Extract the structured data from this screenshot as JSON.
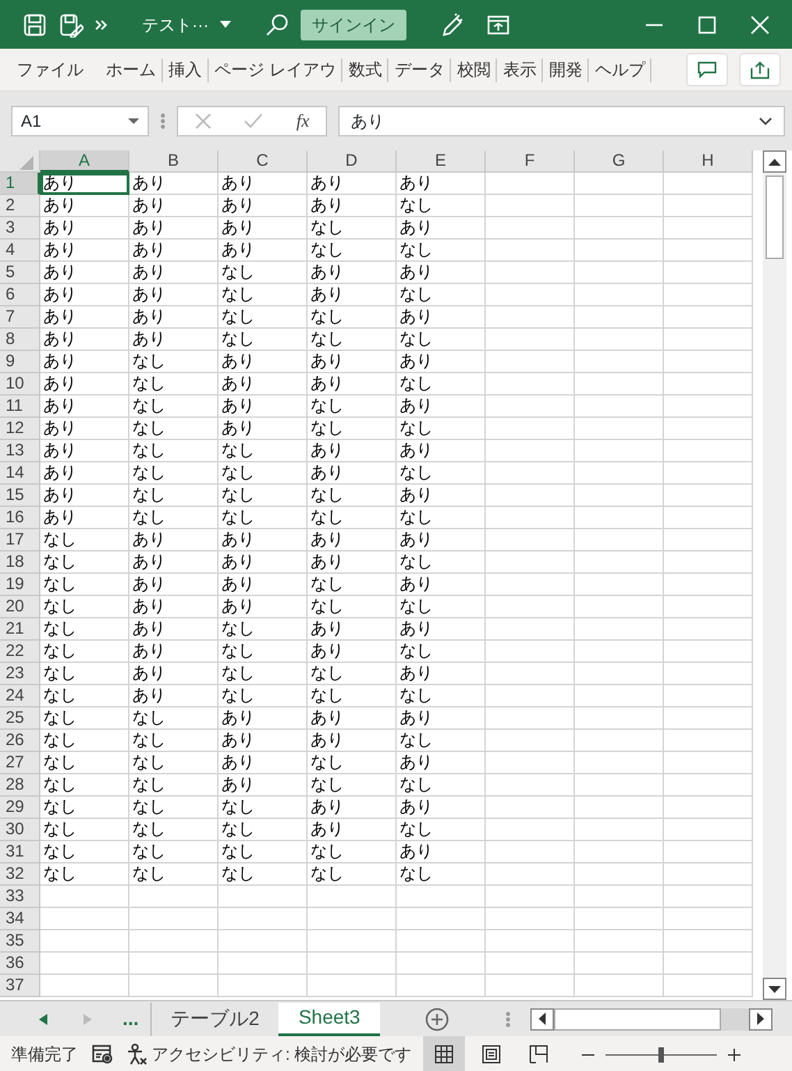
{
  "title_bar": {
    "title": "テスト···",
    "signin": "サインイン"
  },
  "ribbon_tabs": [
    "ファイル",
    "ホーム",
    "挿入",
    "ページ レイアウ",
    "数式",
    "データ",
    "校閲",
    "表示",
    "開発",
    "ヘルプ"
  ],
  "formula_bar": {
    "name_box": "A1",
    "fx": "fx",
    "value": "あり"
  },
  "columns": [
    {
      "label": "A",
      "selected": true
    },
    {
      "label": "B",
      "selected": false
    },
    {
      "label": "C",
      "selected": false
    },
    {
      "label": "D",
      "selected": false
    },
    {
      "label": "E",
      "selected": false
    },
    {
      "label": "F",
      "selected": false
    },
    {
      "label": "G",
      "selected": false
    },
    {
      "label": "H",
      "selected": false
    }
  ],
  "row_headers": [
    {
      "label": "1",
      "selected": true
    },
    {
      "label": "2",
      "selected": false
    },
    {
      "label": "3",
      "selected": false
    },
    {
      "label": "4",
      "selected": false
    },
    {
      "label": "5",
      "selected": false
    },
    {
      "label": "6",
      "selected": false
    },
    {
      "label": "7",
      "selected": false
    },
    {
      "label": "8",
      "selected": false
    },
    {
      "label": "9",
      "selected": false
    },
    {
      "label": "10",
      "selected": false
    },
    {
      "label": "11",
      "selected": false
    },
    {
      "label": "12",
      "selected": false
    },
    {
      "label": "13",
      "selected": false
    },
    {
      "label": "14",
      "selected": false
    },
    {
      "label": "15",
      "selected": false
    },
    {
      "label": "16",
      "selected": false
    },
    {
      "label": "17",
      "selected": false
    },
    {
      "label": "18",
      "selected": false
    },
    {
      "label": "19",
      "selected": false
    },
    {
      "label": "20",
      "selected": false
    },
    {
      "label": "21",
      "selected": false
    },
    {
      "label": "22",
      "selected": false
    },
    {
      "label": "23",
      "selected": false
    },
    {
      "label": "24",
      "selected": false
    },
    {
      "label": "25",
      "selected": false
    },
    {
      "label": "26",
      "selected": false
    },
    {
      "label": "27",
      "selected": false
    },
    {
      "label": "28",
      "selected": false
    },
    {
      "label": "29",
      "selected": false
    },
    {
      "label": "30",
      "selected": false
    },
    {
      "label": "31",
      "selected": false
    },
    {
      "label": "32",
      "selected": false
    },
    {
      "label": "33",
      "selected": false
    },
    {
      "label": "34",
      "selected": false
    },
    {
      "label": "35",
      "selected": false
    },
    {
      "label": "36",
      "selected": false
    },
    {
      "label": "37",
      "selected": false
    }
  ],
  "rows": [
    [
      "あり",
      "あり",
      "あり",
      "あり",
      "あり"
    ],
    [
      "あり",
      "あり",
      "あり",
      "あり",
      "なし"
    ],
    [
      "あり",
      "あり",
      "あり",
      "なし",
      "あり"
    ],
    [
      "あり",
      "あり",
      "あり",
      "なし",
      "なし"
    ],
    [
      "あり",
      "あり",
      "なし",
      "あり",
      "あり"
    ],
    [
      "あり",
      "あり",
      "なし",
      "あり",
      "なし"
    ],
    [
      "あり",
      "あり",
      "なし",
      "なし",
      "あり"
    ],
    [
      "あり",
      "あり",
      "なし",
      "なし",
      "なし"
    ],
    [
      "あり",
      "なし",
      "あり",
      "あり",
      "あり"
    ],
    [
      "あり",
      "なし",
      "あり",
      "あり",
      "なし"
    ],
    [
      "あり",
      "なし",
      "あり",
      "なし",
      "あり"
    ],
    [
      "あり",
      "なし",
      "あり",
      "なし",
      "なし"
    ],
    [
      "あり",
      "なし",
      "なし",
      "あり",
      "あり"
    ],
    [
      "あり",
      "なし",
      "なし",
      "あり",
      "なし"
    ],
    [
      "あり",
      "なし",
      "なし",
      "なし",
      "あり"
    ],
    [
      "あり",
      "なし",
      "なし",
      "なし",
      "なし"
    ],
    [
      "なし",
      "あり",
      "あり",
      "あり",
      "あり"
    ],
    [
      "なし",
      "あり",
      "あり",
      "あり",
      "なし"
    ],
    [
      "なし",
      "あり",
      "あり",
      "なし",
      "あり"
    ],
    [
      "なし",
      "あり",
      "あり",
      "なし",
      "なし"
    ],
    [
      "なし",
      "あり",
      "なし",
      "あり",
      "あり"
    ],
    [
      "なし",
      "あり",
      "なし",
      "あり",
      "なし"
    ],
    [
      "なし",
      "あり",
      "なし",
      "なし",
      "あり"
    ],
    [
      "なし",
      "あり",
      "なし",
      "なし",
      "なし"
    ],
    [
      "なし",
      "なし",
      "あり",
      "あり",
      "あり"
    ],
    [
      "なし",
      "なし",
      "あり",
      "あり",
      "なし"
    ],
    [
      "なし",
      "なし",
      "あり",
      "なし",
      "あり"
    ],
    [
      "なし",
      "なし",
      "あり",
      "なし",
      "なし"
    ],
    [
      "なし",
      "なし",
      "なし",
      "あり",
      "あり"
    ],
    [
      "なし",
      "なし",
      "なし",
      "あり",
      "なし"
    ],
    [
      "なし",
      "なし",
      "なし",
      "なし",
      "あり"
    ],
    [
      "なし",
      "なし",
      "なし",
      "なし",
      "なし"
    ]
  ],
  "sheet_tabs": {
    "more": "...",
    "tabs": [
      {
        "label": "テーブル2",
        "selected": false
      },
      {
        "label": "Sheet3",
        "selected": true
      }
    ]
  },
  "status_bar": {
    "status": "準備完了",
    "accessibility": "アクセシビリティ: 検討が必要です",
    "zoom": {
      "level": 0.5
    }
  }
}
